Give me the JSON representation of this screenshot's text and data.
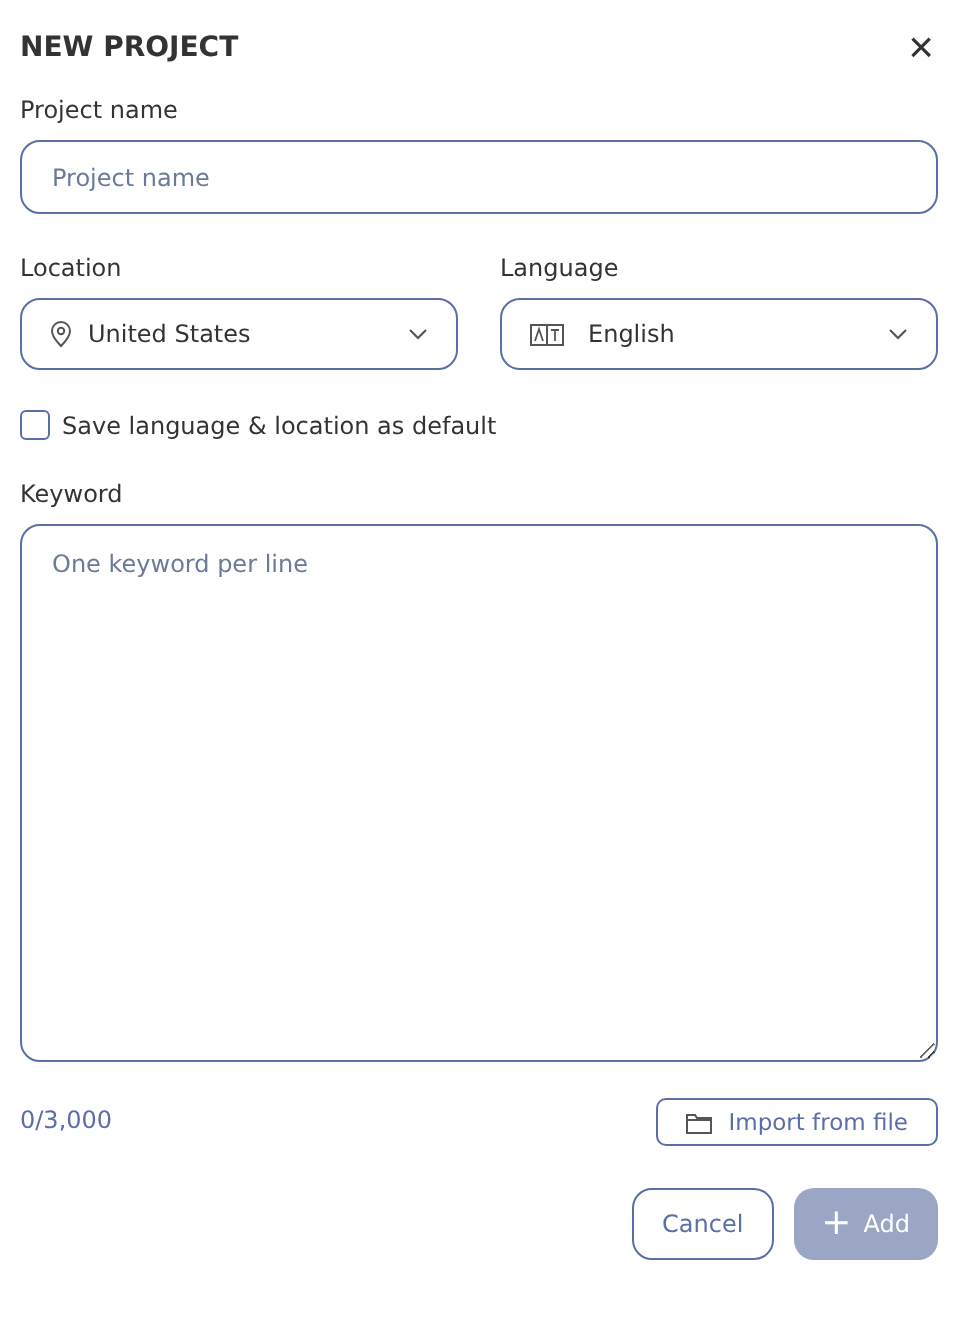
{
  "dialog": {
    "title": "NEW PROJECT",
    "close": "×"
  },
  "project_name": {
    "label": "Project name",
    "placeholder": "Project name"
  },
  "location": {
    "label": "Location",
    "value": "United States"
  },
  "language": {
    "label": "Language",
    "value": "English"
  },
  "save_default": {
    "label": "Save language & location as default",
    "checked": false
  },
  "keyword": {
    "label": "Keyword",
    "placeholder": "One keyword per line",
    "counter": "0/3,000"
  },
  "import_button": {
    "label": "Import from file"
  },
  "buttons": [
    {
      "label": "Cancel",
      "kind": "secondary",
      "disabled": false
    },
    {
      "label": "Add",
      "kind": "primary",
      "disabled": true,
      "icon": "+"
    }
  ]
}
